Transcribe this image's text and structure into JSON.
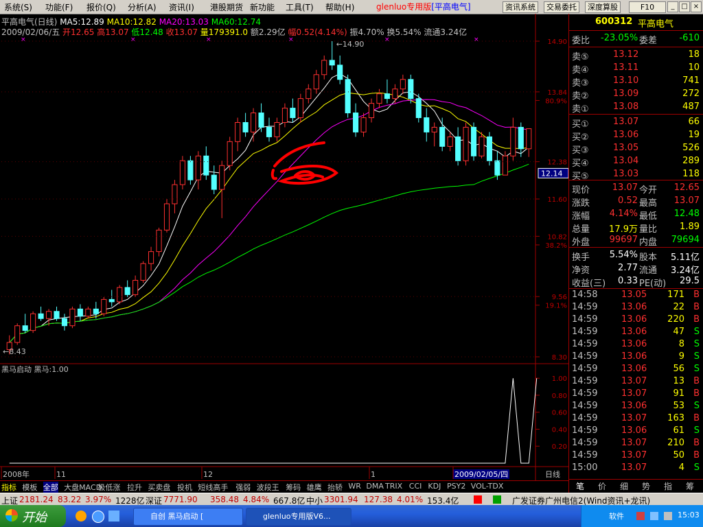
{
  "menu": {
    "items": [
      "系统(S)",
      "功能(F)",
      "报价(Q)",
      "分析(A)",
      "资讯(I)",
      "港股期货",
      "新功能",
      "工具(T)",
      "帮助(H)"
    ],
    "brand_prefix": "glenluo专用版",
    "brand_stock": "[平高电气]",
    "buttons": [
      "资讯系统",
      "交易委托",
      "深度算股",
      "F10"
    ],
    "win": [
      "_",
      "□",
      "×"
    ]
  },
  "info": {
    "title": "平高电气(日线)",
    "ma5": "MA5:12.89",
    "ma10": "MA10:12.82",
    "ma20": "MA20:13.03",
    "ma60": "MA60:12.74",
    "date": "2009/02/06/五",
    "open": "开12.65",
    "high": "高13.07",
    "low": "低12.48",
    "close": "收13.07",
    "vol": "量179391.0",
    "amt": "额2.29亿",
    "chg": "幅0.52(4.14%)",
    "amp": "振4.70%",
    "turn": "换5.54%",
    "float": "流通3.24亿"
  },
  "chart_data": [
    {
      "type": "candlestick",
      "title": "平高电气(日线)",
      "y_ticks": [
        "14.90",
        "13.84",
        "80.9%",
        "12.38",
        "11.60",
        "10.82",
        "38.2%",
        "9.56",
        "19.1%",
        "8.30"
      ],
      "ylim": [
        8.3,
        14.9
      ],
      "max_label": "14.90",
      "min_label": "8.43",
      "current_price_tag": "12.14",
      "x_labels": [
        "2008年",
        "11",
        "12",
        "1",
        "2009/02/05/四"
      ],
      "ma_colors": {
        "ma5": "#ffffff",
        "ma10": "#ffff00",
        "ma20": "#ff00ff",
        "ma60": "#00ff00"
      },
      "candles": [
        [
          8.45,
          8.75,
          8.35,
          8.6
        ],
        [
          8.6,
          9.0,
          8.55,
          8.95
        ],
        [
          8.95,
          9.2,
          8.8,
          8.85
        ],
        [
          8.85,
          9.25,
          8.8,
          9.2
        ],
        [
          9.2,
          9.35,
          9.05,
          9.1
        ],
        [
          9.1,
          9.3,
          8.95,
          9.25
        ],
        [
          9.25,
          9.35,
          9.05,
          9.1
        ],
        [
          9.1,
          9.2,
          8.85,
          8.95
        ],
        [
          8.95,
          9.35,
          8.9,
          9.3
        ],
        [
          9.3,
          9.4,
          9.05,
          9.15
        ],
        [
          9.15,
          9.35,
          9.1,
          9.3
        ],
        [
          9.3,
          9.45,
          9.1,
          9.2
        ],
        [
          9.2,
          9.55,
          9.15,
          9.5
        ],
        [
          9.5,
          9.7,
          9.35,
          9.45
        ],
        [
          9.45,
          9.8,
          9.4,
          9.75
        ],
        [
          9.75,
          9.9,
          9.55,
          9.6
        ],
        [
          9.6,
          10.0,
          9.55,
          9.9
        ],
        [
          9.9,
          10.3,
          9.85,
          10.25
        ],
        [
          10.25,
          10.6,
          10.1,
          10.5
        ],
        [
          10.5,
          11.0,
          10.4,
          10.95
        ],
        [
          10.95,
          11.6,
          10.9,
          11.5
        ],
        [
          11.5,
          12.0,
          11.3,
          11.9
        ],
        [
          11.9,
          12.5,
          11.8,
          12.4
        ],
        [
          12.4,
          12.5,
          11.9,
          12.0
        ],
        [
          12.0,
          12.6,
          11.8,
          12.5
        ],
        [
          12.5,
          12.7,
          12.0,
          12.1
        ],
        [
          12.1,
          12.3,
          11.7,
          11.8
        ],
        [
          11.8,
          12.4,
          11.2,
          12.3
        ],
        [
          12.3,
          12.9,
          12.2,
          12.8
        ],
        [
          12.8,
          13.3,
          12.6,
          13.2
        ],
        [
          13.2,
          13.4,
          12.9,
          13.0
        ],
        [
          13.0,
          13.5,
          12.8,
          13.4
        ],
        [
          13.4,
          13.6,
          13.0,
          13.1
        ],
        [
          13.1,
          13.3,
          12.8,
          12.9
        ],
        [
          12.9,
          13.3,
          12.8,
          13.2
        ],
        [
          13.2,
          13.6,
          13.1,
          13.5
        ],
        [
          13.5,
          13.7,
          13.2,
          13.3
        ],
        [
          13.3,
          13.8,
          13.2,
          13.7
        ],
        [
          13.7,
          14.0,
          13.6,
          13.9
        ],
        [
          13.9,
          14.3,
          13.8,
          14.2
        ],
        [
          14.2,
          14.6,
          14.1,
          14.5
        ],
        [
          14.5,
          14.9,
          14.3,
          14.4
        ],
        [
          14.4,
          14.6,
          14.0,
          14.1
        ],
        [
          14.1,
          14.2,
          13.3,
          13.4
        ],
        [
          13.4,
          13.6,
          12.9,
          13.0
        ],
        [
          13.0,
          13.4,
          12.9,
          13.3
        ],
        [
          13.3,
          13.7,
          13.2,
          13.6
        ],
        [
          13.6,
          13.9,
          13.5,
          13.8
        ],
        [
          13.8,
          14.1,
          13.6,
          13.7
        ],
        [
          13.7,
          14.0,
          13.6,
          13.9
        ],
        [
          13.9,
          14.2,
          13.8,
          14.1
        ],
        [
          14.1,
          14.2,
          13.6,
          13.7
        ],
        [
          13.7,
          13.8,
          13.2,
          13.3
        ],
        [
          13.3,
          13.5,
          12.8,
          13.0
        ],
        [
          13.0,
          13.2,
          12.7,
          13.1
        ],
        [
          13.1,
          13.3,
          12.6,
          12.7
        ],
        [
          12.7,
          13.0,
          12.6,
          12.9
        ],
        [
          12.9,
          13.1,
          12.3,
          12.4
        ],
        [
          12.4,
          13.2,
          12.3,
          13.1
        ],
        [
          13.1,
          13.2,
          12.4,
          12.5
        ],
        [
          12.5,
          13.0,
          12.45,
          12.9
        ],
        [
          12.9,
          13.0,
          12.3,
          12.4
        ],
        [
          12.4,
          12.6,
          12.0,
          12.1
        ],
        [
          12.1,
          12.6,
          12.1,
          12.5
        ],
        [
          12.5,
          13.3,
          12.4,
          13.1
        ],
        [
          13.1,
          13.2,
          12.48,
          12.65
        ],
        [
          12.65,
          13.07,
          12.48,
          13.07
        ]
      ]
    },
    {
      "type": "line",
      "title": "黑马启动",
      "value_label": "黑马:1.00",
      "y_ticks": [
        "1.00",
        "0.80",
        "0.60",
        "0.40",
        "0.20"
      ],
      "ylim": [
        0,
        1.05
      ],
      "values": [
        0,
        0,
        0,
        0,
        0,
        0,
        0,
        0,
        0,
        0,
        0,
        0,
        0,
        0,
        0,
        0,
        0,
        0,
        0,
        0,
        0,
        0,
        0,
        0,
        0,
        0,
        0,
        0,
        0,
        0,
        0,
        0,
        0,
        0,
        0,
        0,
        0,
        0,
        0,
        0,
        0,
        0,
        0,
        0,
        0,
        0,
        0,
        0,
        0,
        0,
        0,
        0,
        0,
        0,
        0,
        0,
        0,
        0,
        0,
        0,
        0,
        0,
        0,
        0,
        1,
        0,
        0,
        1
      ]
    }
  ],
  "bottom_tabs": [
    "指标",
    "模板",
    "全部",
    "大盘MACD",
    "极低涨",
    "拉升",
    "买卖盘",
    "投机",
    "短线高手",
    "强弱",
    "波段王",
    "筹码",
    "雄鹰",
    "抬轿",
    "WR",
    "DMA",
    "TRIX",
    "CCI",
    "KDJ",
    "PSY2",
    "VOL-TDX"
  ],
  "right_panel": {
    "code": "600312",
    "name": "平高电气",
    "weibi_label": "委比",
    "weibi": "-23.05%",
    "weicha_label": "委差",
    "weicha": "-610",
    "sell": [
      {
        "label": "卖⑤",
        "price": "13.12",
        "vol": "18"
      },
      {
        "label": "卖④",
        "price": "13.11",
        "vol": "10"
      },
      {
        "label": "卖③",
        "price": "13.10",
        "vol": "741"
      },
      {
        "label": "卖②",
        "price": "13.09",
        "vol": "272"
      },
      {
        "label": "卖①",
        "price": "13.08",
        "vol": "487"
      }
    ],
    "buy": [
      {
        "label": "买①",
        "price": "13.07",
        "vol": "66"
      },
      {
        "label": "买②",
        "price": "13.06",
        "vol": "19"
      },
      {
        "label": "买③",
        "price": "13.05",
        "vol": "526"
      },
      {
        "label": "买④",
        "price": "13.04",
        "vol": "289"
      },
      {
        "label": "买⑤",
        "price": "13.03",
        "vol": "118"
      }
    ],
    "stats": [
      {
        "l1": "现价",
        "v1": "13.07",
        "c1": "#ff3030",
        "l2": "今开",
        "v2": "12.65",
        "c2": "#ff3030"
      },
      {
        "l1": "涨跌",
        "v1": "0.52",
        "c1": "#ff3030",
        "l2": "最高",
        "v2": "13.07",
        "c2": "#ff3030"
      },
      {
        "l1": "涨幅",
        "v1": "4.14%",
        "c1": "#ff3030",
        "l2": "最低",
        "v2": "12.48",
        "c2": "#00ff00"
      },
      {
        "l1": "总量",
        "v1": "17.9万",
        "c1": "#ffff00",
        "l2": "量比",
        "v2": "1.89",
        "c2": "#ffff00"
      },
      {
        "l1": "外盘",
        "v1": "99697",
        "c1": "#ff3030",
        "l2": "内盘",
        "v2": "79694",
        "c2": "#00ff00"
      }
    ],
    "stats2": [
      {
        "l1": "换手",
        "v1": "5.54%",
        "l2": "股本",
        "v2": "5.11亿"
      },
      {
        "l1": "净资",
        "v1": "2.77",
        "l2": "流通",
        "v2": "3.24亿"
      },
      {
        "l1": "收益(三)",
        "v1": "0.33",
        "l2": "PE(动)",
        "v2": "29.5"
      }
    ],
    "ticks": [
      {
        "t": "14:58",
        "p": "13.05",
        "v": "171",
        "s": "B"
      },
      {
        "t": "14:59",
        "p": "13.06",
        "v": "22",
        "s": "B"
      },
      {
        "t": "14:59",
        "p": "13.06",
        "v": "220",
        "s": "B"
      },
      {
        "t": "14:59",
        "p": "13.06",
        "v": "47",
        "s": "S"
      },
      {
        "t": "14:59",
        "p": "13.06",
        "v": "8",
        "s": "S"
      },
      {
        "t": "14:59",
        "p": "13.06",
        "v": "9",
        "s": "S"
      },
      {
        "t": "14:59",
        "p": "13.06",
        "v": "56",
        "s": "S"
      },
      {
        "t": "14:59",
        "p": "13.07",
        "v": "13",
        "s": "B"
      },
      {
        "t": "14:59",
        "p": "13.07",
        "v": "91",
        "s": "B"
      },
      {
        "t": "14:59",
        "p": "13.06",
        "v": "53",
        "s": "S"
      },
      {
        "t": "14:59",
        "p": "13.07",
        "v": "163",
        "s": "B"
      },
      {
        "t": "14:59",
        "p": "13.06",
        "v": "61",
        "s": "S"
      },
      {
        "t": "14:59",
        "p": "13.07",
        "v": "210",
        "s": "B"
      },
      {
        "t": "14:59",
        "p": "13.07",
        "v": "50",
        "s": "B"
      },
      {
        "t": "15:00",
        "p": "13.07",
        "v": "4",
        "s": "S"
      }
    ],
    "tabs": [
      "笔",
      "价",
      "细",
      "势",
      "指",
      "筹"
    ]
  },
  "status": {
    "sh_label": "上证",
    "sh_val": "2181.24",
    "sh_chg": "83.22",
    "sh_pct": "3.97%",
    "sh_amt": "1228亿",
    "sz_label": "深证",
    "sz_val": "7771.90",
    "sz_chg": "358.48",
    "sz_pct": "4.84%",
    "sz_amt": "667.8亿",
    "zx_label": "中小",
    "zx_val": "3301.94",
    "zx_chg": "127.38",
    "zx_pct": "4.01%",
    "zx_amt": "153.4亿",
    "broker": "广发证券广州电信2(Wind资讯+龙讯)"
  },
  "taskbar": {
    "start": "开始",
    "tasks": [
      "自创 黑马启动 [",
      "glenluo专用版V6..."
    ],
    "tray_text": "软件",
    "clock": "15:03"
  }
}
